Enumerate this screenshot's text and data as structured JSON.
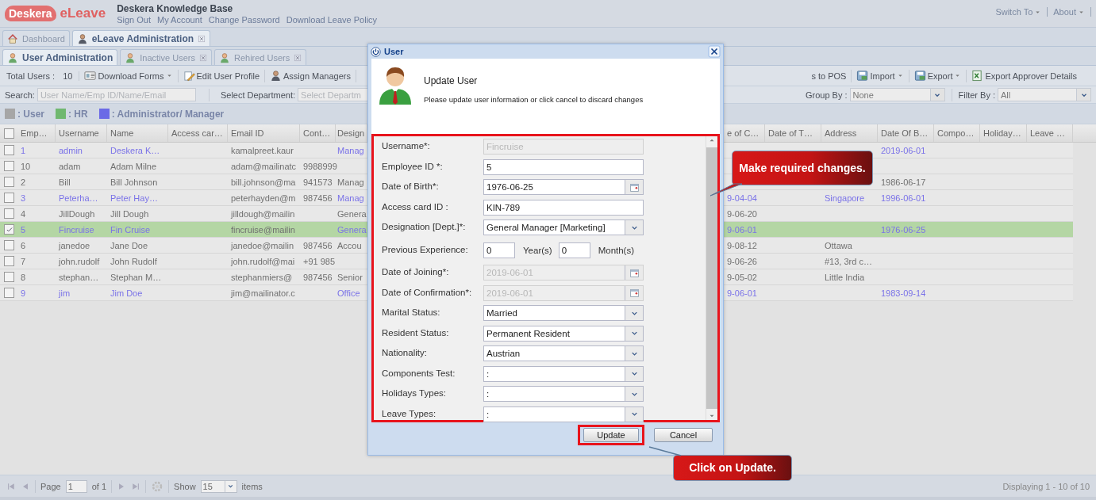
{
  "header": {
    "logo": "Deskera",
    "app_name": "eLeave",
    "site_title": "Deskera Knowledge Base",
    "links": [
      "Sign Out",
      "My Account",
      "Change Password",
      "Download Leave Policy"
    ],
    "menus": [
      "Switch To",
      "About"
    ]
  },
  "main_tabs": [
    {
      "label": "Dashboard",
      "selected": false,
      "closable": false
    },
    {
      "label": "eLeave Administration",
      "selected": true,
      "closable": true
    }
  ],
  "sub_tabs": [
    {
      "label": "User Administration",
      "selected": true,
      "closable": false
    },
    {
      "label": "Inactive Users",
      "selected": false,
      "closable": true
    },
    {
      "label": "Rehired Users",
      "selected": false,
      "closable": true
    }
  ],
  "toolbar": {
    "total_label": "Total Users :",
    "total": "10",
    "left_buttons": [
      {
        "label": "Download Forms",
        "menu": true
      },
      {
        "label": "Edit User Profile",
        "menu": false
      },
      {
        "label": "Assign Managers",
        "menu": false
      }
    ],
    "right_buttons": [
      {
        "label": "s to POS",
        "menu": false
      },
      {
        "label": "Import",
        "menu": true
      },
      {
        "label": "Export",
        "menu": true
      },
      {
        "label": "Export Approver Details",
        "menu": false
      }
    ]
  },
  "filters": {
    "search_label": "Search:",
    "search_placeholder": "User Name/Emp ID/Name/Email",
    "department_label": "Select Department:",
    "department_placeholder": "Select Departm",
    "group_label": "Group By :",
    "group_value": "None",
    "filter_label": "Filter By :",
    "filter_value": "All"
  },
  "legend": [
    {
      "label": ": User",
      "color": "#a6a6a6"
    },
    {
      "label": ": HR",
      "color": "#70b870"
    },
    {
      "label": ": Administrator/ Manager",
      "color": "#6b6be6"
    }
  ],
  "grid": {
    "all_checked": false,
    "columns": [
      "Emp…",
      "Username",
      "Name",
      "Access car…",
      "Email ID",
      "Cont…",
      "Design",
      "e of C…",
      "Date of T…",
      "Address",
      "Date Of B…",
      "Compo…",
      "Holiday…",
      "Leave …"
    ],
    "rows": [
      {
        "kind": "admin",
        "selected": false,
        "emp_id": "1",
        "username": "admin",
        "name": "Deskera K…",
        "email": "kamalpreet.kaur",
        "designation": "Manag",
        "birth_date": "2019-06-01"
      },
      {
        "kind": "user",
        "selected": false,
        "emp_id": "10",
        "username": "adam",
        "name": "Adam Milne",
        "email": "adam@mailinatc",
        "contact": "9988999"
      },
      {
        "kind": "user",
        "selected": false,
        "emp_id": "2",
        "username": "Bill",
        "name": "Bill Johnson",
        "email": "bill.johnson@ma",
        "contact": "941573",
        "designation": "Manag",
        "birth_date": "1986-06-17"
      },
      {
        "kind": "admin",
        "selected": false,
        "emp_id": "3",
        "username": "Peterha…",
        "name": "Peter Hay…",
        "email": "peterhayden@m",
        "contact": "987456",
        "designation": "Manag",
        "confirmation_date": "9-04-04",
        "address": "Singapore",
        "birth_date": "1996-06-01"
      },
      {
        "kind": "user",
        "selected": false,
        "emp_id": "4",
        "username": "JillDough",
        "name": "Jill Dough",
        "email": "jilldough@mailin",
        "designation": "Genera",
        "confirmation_date": "9-06-20"
      },
      {
        "kind": "admin",
        "selected": true,
        "emp_id": "5",
        "username": "Fincruise",
        "name": "Fin Cruise",
        "email": "fincruise@mailin",
        "designation": "Genera",
        "confirmation_date": "9-06-01",
        "birth_date": "1976-06-25"
      },
      {
        "kind": "user",
        "selected": false,
        "emp_id": "6",
        "username": "janedoe",
        "name": "Jane Doe",
        "email": "janedoe@mailin",
        "contact": "987456",
        "designation": "Accou",
        "confirmation_date": "9-08-12",
        "address": "Ottawa"
      },
      {
        "kind": "user",
        "selected": false,
        "emp_id": "7",
        "username": "john.rudolf",
        "name": "John Rudolf",
        "email": "john.rudolf@mai",
        "contact": "+91 985",
        "confirmation_date": "9-06-26",
        "address": "#13, 3rd c…"
      },
      {
        "kind": "user",
        "selected": false,
        "emp_id": "8",
        "username": "stephan…",
        "name": "Stephan M…",
        "email": "stephanmiers@",
        "contact": "987456",
        "designation": "Senior",
        "confirmation_date": "9-05-02",
        "address": "Little India"
      },
      {
        "kind": "admin",
        "selected": false,
        "emp_id": "9",
        "username": "jim",
        "name": "Jim Doe",
        "email": "jim@mailinator.c",
        "designation": "Office",
        "confirmation_date": "9-06-01",
        "birth_date": "1983-09-14"
      }
    ]
  },
  "paging": {
    "page_label": "Page",
    "page": "1",
    "of_label": "of 1",
    "show_label": "Show",
    "page_size": "15",
    "items_label": "items",
    "summary": "Displaying 1 - 10 of 10"
  },
  "dialog": {
    "title": "User",
    "heading": "Update User",
    "message": "Please update user information or click cancel to discard changes",
    "highlighted": true,
    "fields": [
      {
        "label": "Username*:",
        "kind": "text",
        "value": "Fincruise",
        "disabled": true
      },
      {
        "label": "Employee ID *:",
        "kind": "text",
        "value": "5",
        "disabled": false
      },
      {
        "label": "Date of Birth*:",
        "kind": "date",
        "value": "1976-06-25",
        "disabled": false
      },
      {
        "label": "Access card ID :",
        "kind": "text",
        "value": "KIN-789",
        "disabled": false
      },
      {
        "label": "Designation [Dept.]*:",
        "kind": "combo",
        "value": "General Manager [Marketing]",
        "disabled": false
      },
      {
        "label": "Previous Experience:",
        "kind": "experience",
        "years": "0",
        "years_unit": "Year(s)",
        "months": "0",
        "months_unit": "Month(s)"
      },
      {
        "label": "Date of Joining*:",
        "kind": "date",
        "value": "2019-06-01",
        "disabled": true
      },
      {
        "label": "Date of Confirmation*:",
        "kind": "date",
        "value": "2019-06-01",
        "disabled": true
      },
      {
        "label": "Marital Status:",
        "kind": "combo",
        "value": "Married",
        "disabled": false
      },
      {
        "label": "Resident Status:",
        "kind": "combo",
        "value": "Permanent Resident",
        "disabled": false
      },
      {
        "label": "Nationality:",
        "kind": "combo",
        "value": "Austrian",
        "disabled": false
      },
      {
        "label": "Components Test:",
        "kind": "combo",
        "value": ":",
        "disabled": false
      },
      {
        "label": "Holidays Types:",
        "kind": "combo",
        "value": ":",
        "disabled": false
      },
      {
        "label": "Leave Types:",
        "kind": "combo",
        "value": ":",
        "disabled": false
      }
    ],
    "buttons": [
      {
        "label": "Update",
        "highlighted": true
      },
      {
        "label": "Cancel",
        "highlighted": false
      }
    ]
  },
  "annotations": [
    {
      "text": "Make required changes."
    },
    {
      "text": "Click on Update."
    }
  ]
}
